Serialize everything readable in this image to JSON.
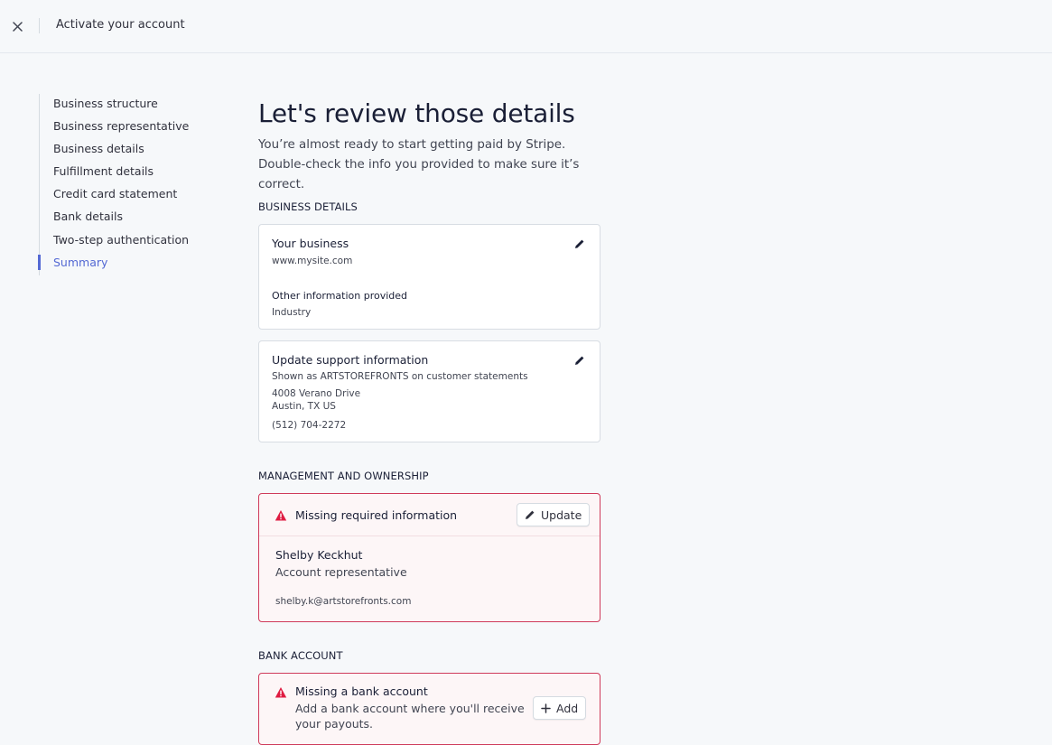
{
  "header": {
    "title": "Activate your account",
    "close_icon": "close-icon"
  },
  "sidebar": {
    "items": [
      {
        "label": "Business structure"
      },
      {
        "label": "Business representative"
      },
      {
        "label": "Business details"
      },
      {
        "label": "Fulfillment details"
      },
      {
        "label": "Credit card statement"
      },
      {
        "label": "Bank details"
      },
      {
        "label": "Two-step authentication"
      },
      {
        "label": "Summary",
        "active": true
      }
    ],
    "active_color": "#5469d4"
  },
  "main": {
    "title": "Let's review those details",
    "subtitle": "You’re almost ready to start getting paid by Stripe. Double-check the info you provided to make sure it’s correct.",
    "business_details": {
      "section_label": "BUSINESS DETAILS",
      "your_business": {
        "title": "Your business",
        "website": "www.mysite.com",
        "other_label": "Other information provided",
        "other_value": "Industry"
      },
      "support": {
        "title": "Update support information",
        "statement": "Shown as ARTSTOREFRONTS on customer statements",
        "address_line1": "4008 Verano Drive",
        "address_line2": "Austin, TX US",
        "phone": "(512) 704-2272"
      }
    },
    "management": {
      "section_label": "MANAGEMENT AND OWNERSHIP",
      "alert_title": "Missing required information",
      "update_label": "Update",
      "person_name": "Shelby Keckhut",
      "person_role": "Account representative",
      "person_email": "shelby.k@artstorefronts.com"
    },
    "bank": {
      "section_label": "BANK ACCOUNT",
      "alert_title": "Missing a bank account",
      "alert_desc": "Add a bank account where you'll receive your payouts.",
      "add_label": "Add"
    }
  },
  "colors": {
    "alert": "#cf3a5a",
    "accent": "#5469d4"
  }
}
